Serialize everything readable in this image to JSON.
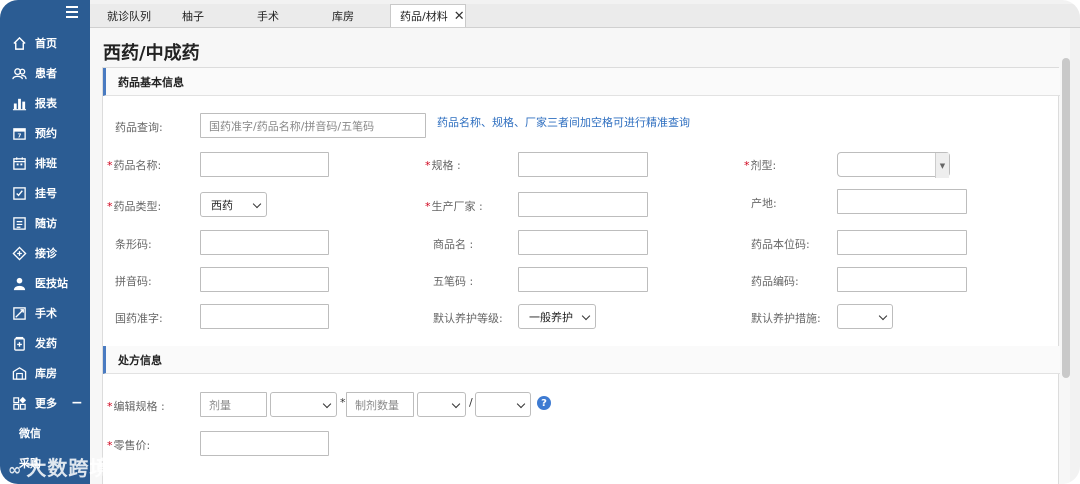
{
  "sidebar": {
    "items": [
      {
        "label": "首页",
        "icon": "home-icon"
      },
      {
        "label": "患者",
        "icon": "users-icon"
      },
      {
        "label": "报表",
        "icon": "bar-chart-icon"
      },
      {
        "label": "预约",
        "icon": "calendar-7-icon"
      },
      {
        "label": "排班",
        "icon": "schedule-icon"
      },
      {
        "label": "挂号",
        "icon": "checklist-icon"
      },
      {
        "label": "随访",
        "icon": "followup-icon"
      },
      {
        "label": "接诊",
        "icon": "diamond-plus-icon"
      },
      {
        "label": "医技站",
        "icon": "doctor-icon"
      },
      {
        "label": "手术",
        "icon": "surgery-icon"
      },
      {
        "label": "发药",
        "icon": "medicine-icon"
      },
      {
        "label": "库房",
        "icon": "warehouse-icon"
      },
      {
        "label": "更多",
        "icon": "more-grid-icon"
      }
    ],
    "more_toggle": "−",
    "sub_items": [
      "微信",
      "采购"
    ]
  },
  "tabs": [
    {
      "label": "就诊队列"
    },
    {
      "label": "柚子"
    },
    {
      "label": "手术"
    },
    {
      "label": "库房"
    },
    {
      "label": "药品/材料",
      "active": true
    }
  ],
  "page": {
    "title": "西药/中成药"
  },
  "basic": {
    "section_title": "药品基本信息",
    "query_label": "药品查询:",
    "query_placeholder": "国药准字/药品名称/拼音码/五笔码",
    "query_hint": "药品名称、规格、厂家三者间加空格可进行精准查询",
    "name_label": "药品名称:",
    "spec_label": "规格 :",
    "dosage_form_label": "剂型:",
    "type_label": "药品类型:",
    "type_value": "西药",
    "manufacturer_label": "生产厂家 :",
    "origin_label": "产地:",
    "barcode_label": "条形码:",
    "trade_name_label": "商品名 :",
    "unit_code_label": "药品本位码:",
    "pinyin_label": "拼音码:",
    "wubi_label": "五笔码 :",
    "drug_code_label": "药品编码:",
    "approval_label": "国药准字:",
    "care_level_label": "默认养护等级:",
    "care_level_value": "一般养护",
    "care_measure_label": "默认养护措施:"
  },
  "prescription": {
    "section_title": "处方信息",
    "edit_spec_label": "编辑规格 :",
    "dose_placeholder": "剂量",
    "prep_qty_placeholder": "制剂数量",
    "star": "*",
    "slash": "/",
    "help": "?",
    "retail_price_label": "零售价:"
  },
  "watermark": "大数跨境",
  "required_mark": "*",
  "colors": {
    "sidebar": "#2b5c93",
    "accent": "#4a7bc1",
    "hint": "#2f6fc0",
    "required": "#d0021b"
  }
}
